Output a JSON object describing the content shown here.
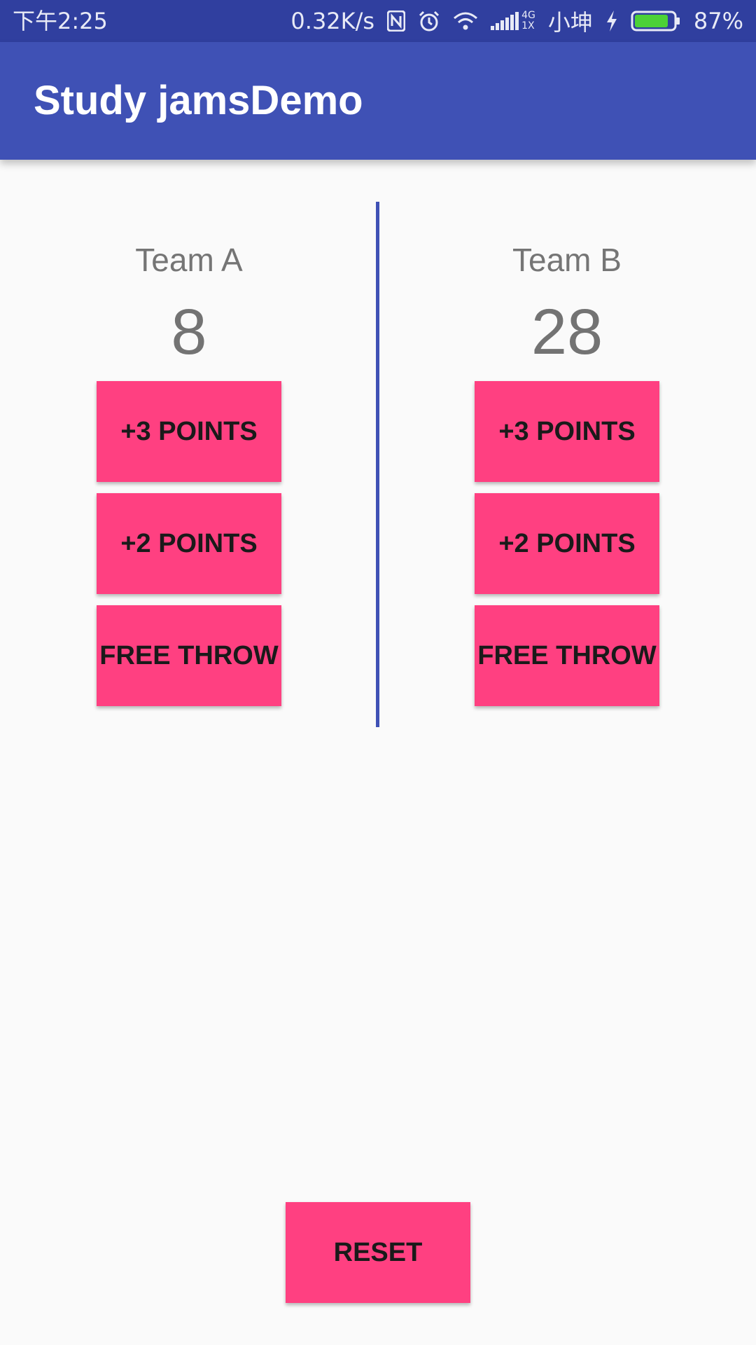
{
  "status_bar": {
    "time": "下午2:25",
    "speed": "0.32K/s",
    "network_top": "4G",
    "network_bottom": "1X",
    "carrier": "小坤",
    "battery": "87%",
    "battery_level": 0.87,
    "battery_color": "#4cd137",
    "icons": [
      "nfc-icon",
      "alarm-icon",
      "wifi-icon",
      "signal-icon",
      "charging-icon",
      "battery-icon"
    ]
  },
  "app_bar": {
    "title": "Study jamsDemo",
    "color": "#3f51b5"
  },
  "team_a": {
    "name": "Team A",
    "score": "8",
    "buttons": [
      "+3 POINTS",
      "+2 POINTS",
      "FREE THROW"
    ]
  },
  "team_b": {
    "name": "Team B",
    "score": "28",
    "buttons": [
      "+3 POINTS",
      "+2 POINTS",
      "FREE THROW"
    ]
  },
  "reset_label": "RESET",
  "accent_color": "#ff4081"
}
